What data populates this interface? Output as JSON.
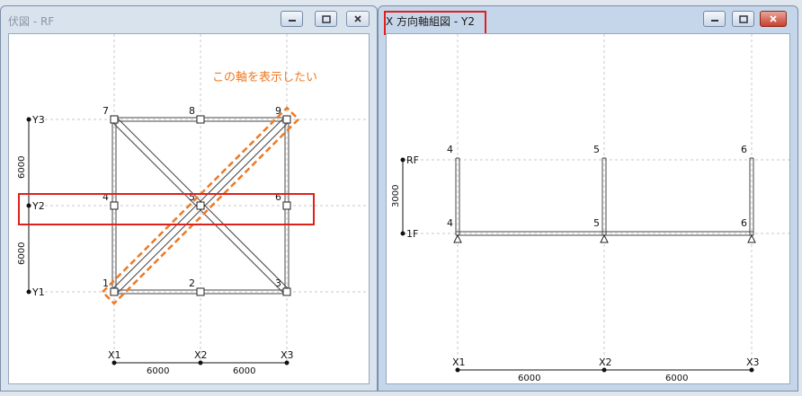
{
  "windows": {
    "plan": {
      "title": "伏図 - RF",
      "annotation": "この軸を表示したい",
      "grid_y": [
        {
          "label": "Y3"
        },
        {
          "label": "Y2"
        },
        {
          "label": "Y1"
        }
      ],
      "grid_x": [
        {
          "label": "X1"
        },
        {
          "label": "X2"
        },
        {
          "label": "X3"
        }
      ],
      "y_spans": [
        "6000",
        "6000"
      ],
      "x_spans": [
        "6000",
        "6000"
      ],
      "nodes": [
        {
          "label": "7"
        },
        {
          "label": "8"
        },
        {
          "label": "9"
        },
        {
          "label": "4"
        },
        {
          "label": "5"
        },
        {
          "label": "6"
        },
        {
          "label": "1"
        },
        {
          "label": "2"
        },
        {
          "label": "3"
        }
      ]
    },
    "frame": {
      "title": "X 方向軸組図 - Y2",
      "levels": [
        {
          "label": "RF"
        },
        {
          "label": "1F"
        }
      ],
      "height_span": "3000",
      "grid_x": [
        {
          "label": "X1"
        },
        {
          "label": "X2"
        },
        {
          "label": "X3"
        }
      ],
      "x_spans": [
        "6000",
        "6000"
      ],
      "top_nodes": [
        {
          "label": "4"
        },
        {
          "label": "5"
        },
        {
          "label": "6"
        }
      ],
      "bottom_nodes": [
        {
          "label": "4"
        },
        {
          "label": "5"
        },
        {
          "label": "6"
        }
      ]
    }
  },
  "colors": {
    "highlight_red": "#e0201c",
    "highlight_orange": "#f07820",
    "annotation_text": "#f07820",
    "gridline": "#c8c8c8"
  },
  "icons": {
    "minimize": "minimize-icon",
    "maximize": "maximize-icon",
    "close": "close-icon"
  }
}
